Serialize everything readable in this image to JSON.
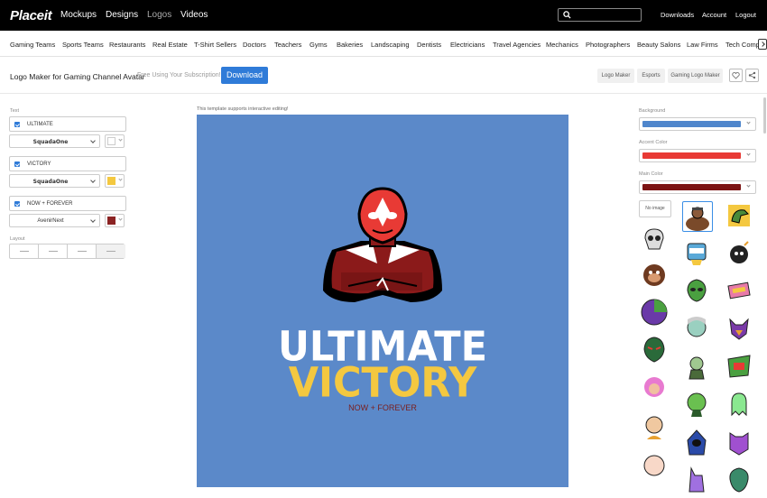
{
  "brand": "Placeit",
  "topnav": [
    "Mockups",
    "Designs",
    "Logos",
    "Videos"
  ],
  "search": {
    "placeholder": ""
  },
  "utility_links": [
    "Downloads",
    "Account",
    "Logout"
  ],
  "categories": [
    "Gaming Teams",
    "Sports Teams",
    "Restaurants",
    "Real Estate",
    "T-Shirt Sellers",
    "Doctors",
    "Teachers",
    "Gyms",
    "Bakeries",
    "Landscaping",
    "Dentists",
    "Electricians",
    "Travel Agencies",
    "Mechanics",
    "Photographers",
    "Beauty Salons",
    "Law Firms",
    "Tech Comp"
  ],
  "header": {
    "title": "Logo Maker for Gaming Channel Avatar",
    "subtitle": "Free Using Your Subscription!",
    "download_label": "Download",
    "tags": [
      "Logo Maker",
      "Esports",
      "Gaming Logo Maker"
    ]
  },
  "left_panel": {
    "text_label": "Text",
    "fields": [
      {
        "value": "ULTIMATE",
        "font": "SquadaOne",
        "swatch": "#ffffff"
      },
      {
        "value": "VICTORY",
        "font": "SquadaOne",
        "swatch": "#f4c840"
      },
      {
        "value": "NOW + FOREVER",
        "font": "AvenirNext",
        "swatch": "#8b2323"
      }
    ],
    "layout_label": "Layout"
  },
  "canvas": {
    "notice": "This template supports interactive editing!",
    "line1": "ULTIMATE",
    "line2": "VICTORY",
    "line3": "NOW + FOREVER",
    "background": "#5b89c9"
  },
  "right_panel": {
    "background_label": "Background",
    "background_color": "#4f86cc",
    "accent_label": "Accent Color",
    "accent_color": "#e83a35",
    "main_label": "Main Color",
    "main_color": "#7c1414",
    "no_image_label": "No image",
    "thumbnails": [
      "wrestler",
      "dinosaur",
      "skull",
      "raccoon",
      "bomb-skull",
      "monkey",
      "alien",
      "pink-creature",
      "planet",
      "zombie-girl",
      "fox",
      "luchador",
      "soldier",
      "mecha",
      "pink-hair-girl",
      "alien-2",
      "ghost",
      "bald-man",
      "hooded-figure",
      "purple-cat",
      "baby",
      "purple-unicorn",
      "alien-3"
    ]
  }
}
